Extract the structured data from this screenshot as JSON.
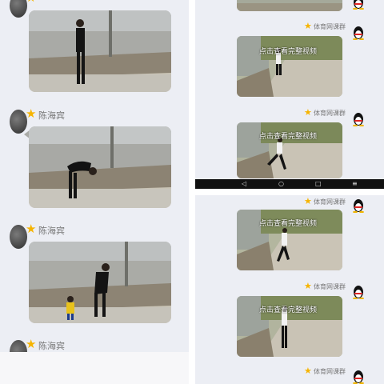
{
  "chat_left": {
    "sender_name": "陈海宾"
  },
  "chat_right": {
    "group_label": "体育网课群",
    "video_caption": "点击查看完整视频"
  },
  "icons": {
    "sender_badge": "star-icon",
    "group_badge": "star-icon",
    "app_avatar": "qq-penguin-icon",
    "nav": [
      "back-icon",
      "home-icon",
      "recent-apps-icon",
      "menu-icon"
    ]
  },
  "colors": {
    "chat_bg": "#eceef4",
    "star": "#f6b400"
  }
}
